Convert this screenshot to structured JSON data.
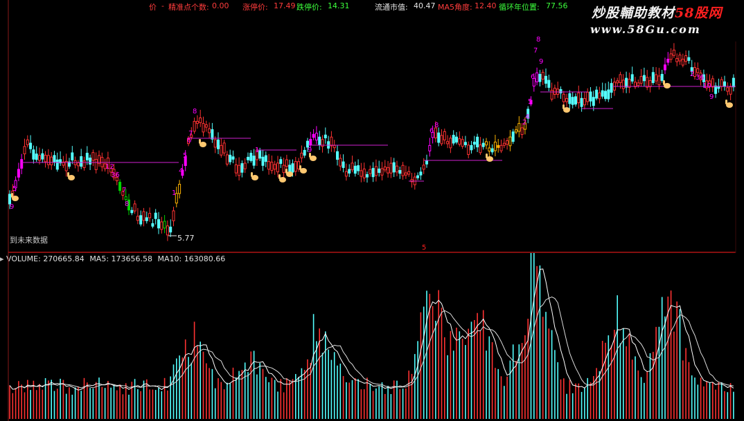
{
  "header": {
    "cut_label": "价",
    "dash": "-",
    "accuracy_label": "精准点个数:",
    "accuracy_value": "0.00",
    "limit_up_label": "涨停价:",
    "limit_up_value": "17.49",
    "limit_down_label": "跌停价:",
    "limit_down_value": "14.31",
    "float_cap_label": "流通市值:",
    "float_cap_value": "40.47",
    "ma5_angle_label": "MA5角度:",
    "ma5_angle_value": "12.40",
    "cycle_label": "循环年位置:",
    "cycle_value": "77.56"
  },
  "watermark": {
    "title_prefix": "炒股輔助教材",
    "title_highlight": "58股网",
    "url": "www.58Gu.com"
  },
  "price_panel": {
    "footer_text": "到未来数据",
    "low_price_label": "5.77",
    "divider_marker": "5",
    "counts_shown": [
      "8",
      "9",
      "7",
      "6",
      "5",
      "4",
      "3",
      "2",
      "1",
      "12",
      "36",
      "9",
      "8"
    ]
  },
  "volume_panel": {
    "volume_label": "VOLUME:",
    "volume_value": "270665.84",
    "ma5_label": "MA5:",
    "ma5_value": "173656.58",
    "ma10_label": "MA10:",
    "ma10_value": "163080.66"
  },
  "colors": {
    "up_candle": "#ff3232",
    "down_candle": "#54ffff",
    "count_label": "#ff00ff",
    "green_candle": "#00d200",
    "signal_bar": "#ff00ff",
    "accent_orange": "#ffb400",
    "hand_icon": "#ffc870"
  },
  "icons": [
    "pointing-hand-icon"
  ]
}
